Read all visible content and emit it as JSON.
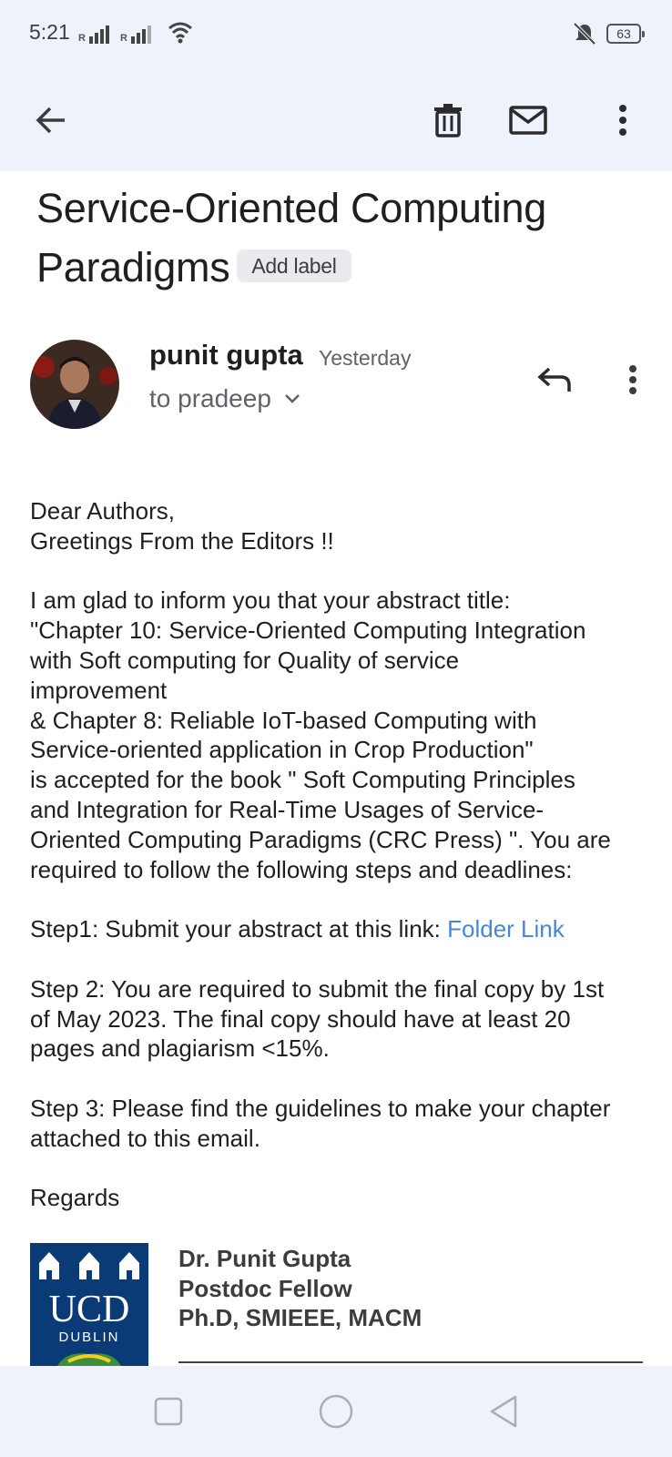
{
  "status_bar": {
    "time": "5:21",
    "signal1_label": "R",
    "signal2_label": "R",
    "battery": "63"
  },
  "toolbar": {
    "back_icon": "arrow-left-icon",
    "delete_icon": "trash-icon",
    "mark_unread_icon": "mail-icon",
    "more_icon": "more-vert-icon"
  },
  "email": {
    "subject": "Service-Oriented Computing Paradigms",
    "add_label": "Add label",
    "sender": "punit gupta",
    "date": "Yesterday",
    "recipient": "to pradeep",
    "body": {
      "greeting1": "Dear Authors,",
      "greeting2": "Greetings From the Editors !!",
      "p1_l1": "I am glad to inform you that your abstract title:",
      "p1_l2": "\"Chapter 10: Service-Oriented Computing Integration",
      "p1_l3": "with Soft computing for Quality of service",
      "p1_l4": "improvement",
      "p1_l5": "& Chapter 8: Reliable IoT-based Computing with",
      "p1_l6": "Service-oriented application in Crop Production\"",
      "p1_l7": "is accepted for the book \" Soft Computing Principles",
      "p1_l8": "and Integration for Real-Time Usages of Service-",
      "p1_l9": "Oriented Computing Paradigms (CRC Press) \". You are",
      "p1_l10": "required to follow the following steps and deadlines:",
      "step1_text": "Step1: Submit your abstract at this link: ",
      "step1_link": "Folder Link",
      "step2_l1": "Step 2: You are required to submit the final copy by 1st",
      "step2_l2": "of May 2023. The final copy should have at least 20",
      "step2_l3": "pages and plagiarism <15%.",
      "step3_l1": "Step 3: Please find the guidelines to make your chapter",
      "step3_l2": "attached to this email.",
      "regards": "Regards"
    },
    "signature": {
      "logo_text": "UCD",
      "logo_sub": "DUBLIN",
      "name": "Dr. Punit Gupta",
      "role": "Postdoc Fellow",
      "credentials": "Ph.D, SMIEEE, MACM"
    }
  },
  "colors": {
    "bar_bg": "#eef2fa",
    "link": "#4a86d6",
    "ucd_blue": "#0b3b77"
  }
}
